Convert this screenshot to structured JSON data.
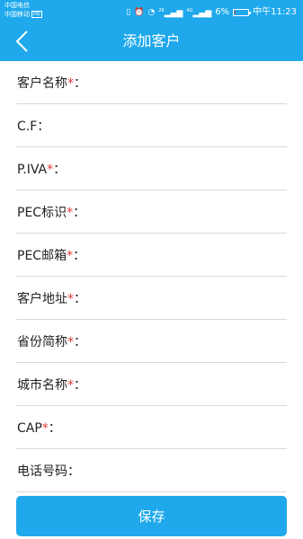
{
  "status_bar": {
    "carrier_1": "中国电信",
    "carrier_2": "中国移动",
    "hd_badge": "HD",
    "signal_1_label": "26",
    "signal_2_label": "4G",
    "battery_text": "6%",
    "battery_level": 0.06,
    "battery_color": "#e23c3c",
    "time": "中午11:23",
    "icons": [
      "vibrate-icon",
      "alarm-icon",
      "wifi-icon",
      "signal-icon",
      "signal-icon",
      "battery-icon"
    ]
  },
  "header": {
    "title": "添加客户",
    "back_icon": "chevron-left-icon"
  },
  "form": {
    "fields": [
      {
        "label": "客户名称",
        "required": "*",
        "colon": "："
      },
      {
        "label": "C.F",
        "required": "",
        "colon": "："
      },
      {
        "label": "P.IVA",
        "required": "*",
        "colon": "："
      },
      {
        "label": "PEC标识",
        "required": "*",
        "colon": "："
      },
      {
        "label": "PEC邮箱",
        "required": "*",
        "colon": "："
      },
      {
        "label": "客户地址",
        "required": "*",
        "colon": "："
      },
      {
        "label": "省份简称",
        "required": "*",
        "colon": "："
      },
      {
        "label": "城市名称",
        "required": "*",
        "colon": "："
      },
      {
        "label": "CAP",
        "required": "*",
        "colon": "："
      },
      {
        "label": "电话号码",
        "required": "",
        "colon": "："
      }
    ]
  },
  "footer": {
    "save_label": "保存"
  },
  "colors": {
    "primary": "#1fa9ec",
    "required_star": "#e53935",
    "divider": "#d9d9d9"
  }
}
